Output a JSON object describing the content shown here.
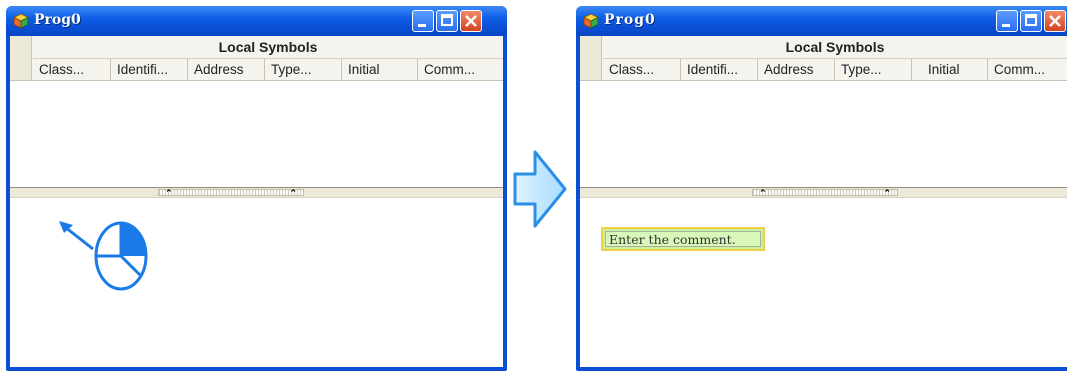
{
  "colors": {
    "titlebar": "#0a4fd6",
    "close_button": "#d3431f",
    "comment_fill": "#c9f39a",
    "comment_border": "#f0cf4a",
    "annotation": "#1a7be8"
  },
  "left_window": {
    "title": "Prog0",
    "section_title": "Local Symbols",
    "columns": [
      "Class...",
      "Identifi...",
      "Address",
      "Type...",
      "Initial",
      "Comm..."
    ],
    "splitter_chevrons": [
      "⌃",
      "⌃"
    ]
  },
  "right_window": {
    "title": "Prog0",
    "section_title": "Local Symbols",
    "columns": [
      "Class...",
      "Identifi...",
      "Address",
      "Type...",
      "Initial",
      "Comm..."
    ],
    "splitter_chevrons": [
      "⌃",
      "⌃"
    ],
    "comment_text": "Enter the comment."
  },
  "annotations": {
    "pointer_icon": "arrow-icon",
    "mouse_icon": "mouse-left-click-icon",
    "transition_icon": "right-arrow-icon"
  }
}
